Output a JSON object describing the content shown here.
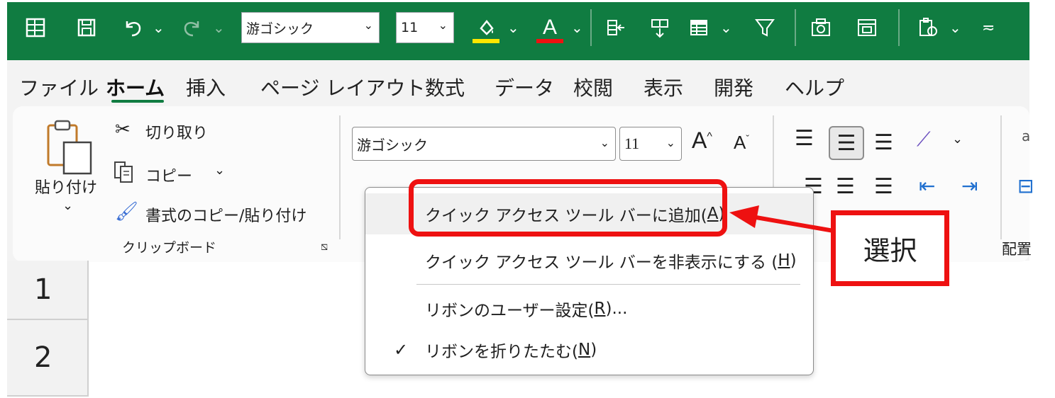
{
  "colors": {
    "excel_green": "#107c41",
    "annotation_red": "#ee1111",
    "fill_yellow": "#ffe600",
    "font_red": "#ee1111"
  },
  "qat": {
    "icons": [
      "excel-icon",
      "save-icon",
      "undo-icon",
      "redo-icon",
      "fill-color-icon",
      "font-color-icon",
      "insert-icon",
      "freeze-panes-icon",
      "table-icon",
      "filter-icon",
      "camera-icon",
      "form-icon",
      "paste-special-icon",
      "customize-icon"
    ],
    "font_name": "游ゴシック",
    "font_size": "11",
    "font_color_letter": "A"
  },
  "tabs": [
    "ファイル",
    "ホーム",
    "挿入",
    "ページ レイアウト",
    "数式",
    "データ",
    "校閲",
    "表示",
    "開発",
    "ヘルプ"
  ],
  "active_tab": "ホーム",
  "ribbon": {
    "clipboard": {
      "paste_label": "貼り付け",
      "cut_label": "切り取り",
      "copy_label": "コピー",
      "format_painter_label": "書式のコピー/貼り付け",
      "group_label": "クリップボード"
    },
    "font": {
      "font_name": "游ゴシック",
      "font_size": "11",
      "grow_label": "A",
      "shrink_label": "A"
    },
    "alignment": {
      "group_label_partial": "配置"
    }
  },
  "sheet": {
    "rows": [
      "1",
      "2"
    ]
  },
  "context_menu": {
    "items": [
      {
        "label": "クイック アクセス ツール バーに追加(",
        "key": "A",
        "suffix": ")"
      },
      {
        "label": "クイック アクセス ツール バーを非表示にする (",
        "key": "H",
        "suffix": ")"
      },
      {
        "label": "リボンのユーザー設定(",
        "key": "R",
        "suffix": ")..."
      },
      {
        "label": "リボンを折りたたむ(",
        "key": "N",
        "suffix": ")",
        "checked": true
      }
    ]
  },
  "annotation": {
    "callout_text": "選択"
  }
}
